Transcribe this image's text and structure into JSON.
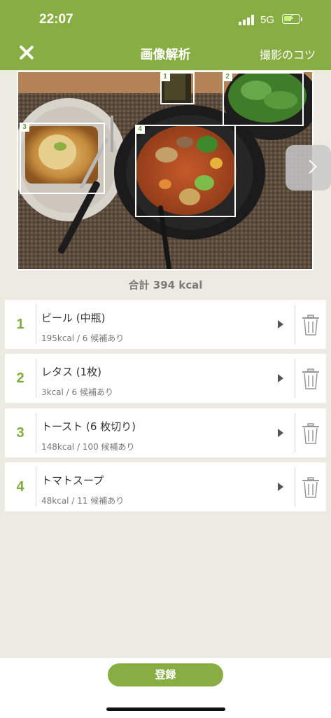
{
  "status": {
    "time": "22:07",
    "network": "5G",
    "battery_state": "charging"
  },
  "header": {
    "title": "画像解析",
    "tips_label": "撮影のコツ",
    "close_icon": "close-icon"
  },
  "photo": {
    "detections": [
      {
        "tag": "1"
      },
      {
        "tag": "2"
      },
      {
        "tag": "3"
      },
      {
        "tag": "4"
      }
    ]
  },
  "summary": {
    "total": "合計 394 kcal"
  },
  "items": [
    {
      "num": "1",
      "name": "ビール (中瓶)",
      "detail": "195kcal / 6 候補あり"
    },
    {
      "num": "2",
      "name": "レタス (1枚)",
      "detail": "3kcal / 6 候補あり"
    },
    {
      "num": "3",
      "name": "トースト (6 枚切り)",
      "detail": "148kcal / 100 候補あり"
    },
    {
      "num": "4",
      "name": "トマトスープ",
      "detail": "48kcal / 11 候補あり"
    }
  ],
  "footer": {
    "register_label": "登録"
  },
  "colors": {
    "brand_green": "#88ad42",
    "number_green": "#7fac3b",
    "background": "#ecebe2"
  }
}
